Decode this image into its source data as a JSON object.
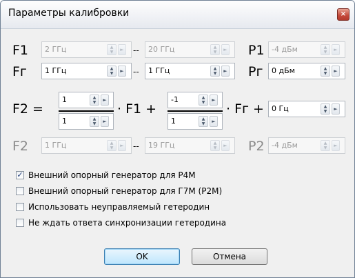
{
  "dialog": {
    "title": "Параметры калибровки",
    "close_glyph": "×"
  },
  "rows": {
    "f1": {
      "label": "F1",
      "from": "2 ГГц",
      "to": "20 ГГц",
      "sep": "--",
      "p_label": "P1",
      "p_value": "-4 дБм"
    },
    "fg": {
      "label": "Fг",
      "from": "1 ГГц",
      "to": "1 ГГц",
      "sep": "--",
      "p_label": "Pг",
      "p_value": "0 дБм"
    },
    "f2eq": {
      "label": "F2 =",
      "num1": "1",
      "den1": "1",
      "mid_text": "· F1 +",
      "num2": "-1",
      "den2": "1",
      "end_text": "· Fг +",
      "offset": "0 Гц"
    },
    "f2": {
      "label": "F2",
      "from": "1 ГГц",
      "to": "19 ГГц",
      "sep": "--",
      "p_label": "P2",
      "p_value": "-4 дБм"
    }
  },
  "spin_glyphs": {
    "up": "▲",
    "down": "▼",
    "right": "►"
  },
  "checkboxes": [
    {
      "label": "Внешний опорный генератор для Р4М",
      "checked": true
    },
    {
      "label": "Внешний опорный генератор для Г7М (Р2М)",
      "checked": false
    },
    {
      "label": "Использовать неуправляемый гетеродин",
      "checked": false
    },
    {
      "label": "Не ждать ответа синхронизации гетеродина",
      "checked": false
    }
  ],
  "check_glyph": "✓",
  "buttons": {
    "ok": "OK",
    "cancel": "Отмена"
  },
  "colors": {
    "accent": "#3c7fb1",
    "close": "#c4493a",
    "disabled_text": "#9a9a9a"
  }
}
